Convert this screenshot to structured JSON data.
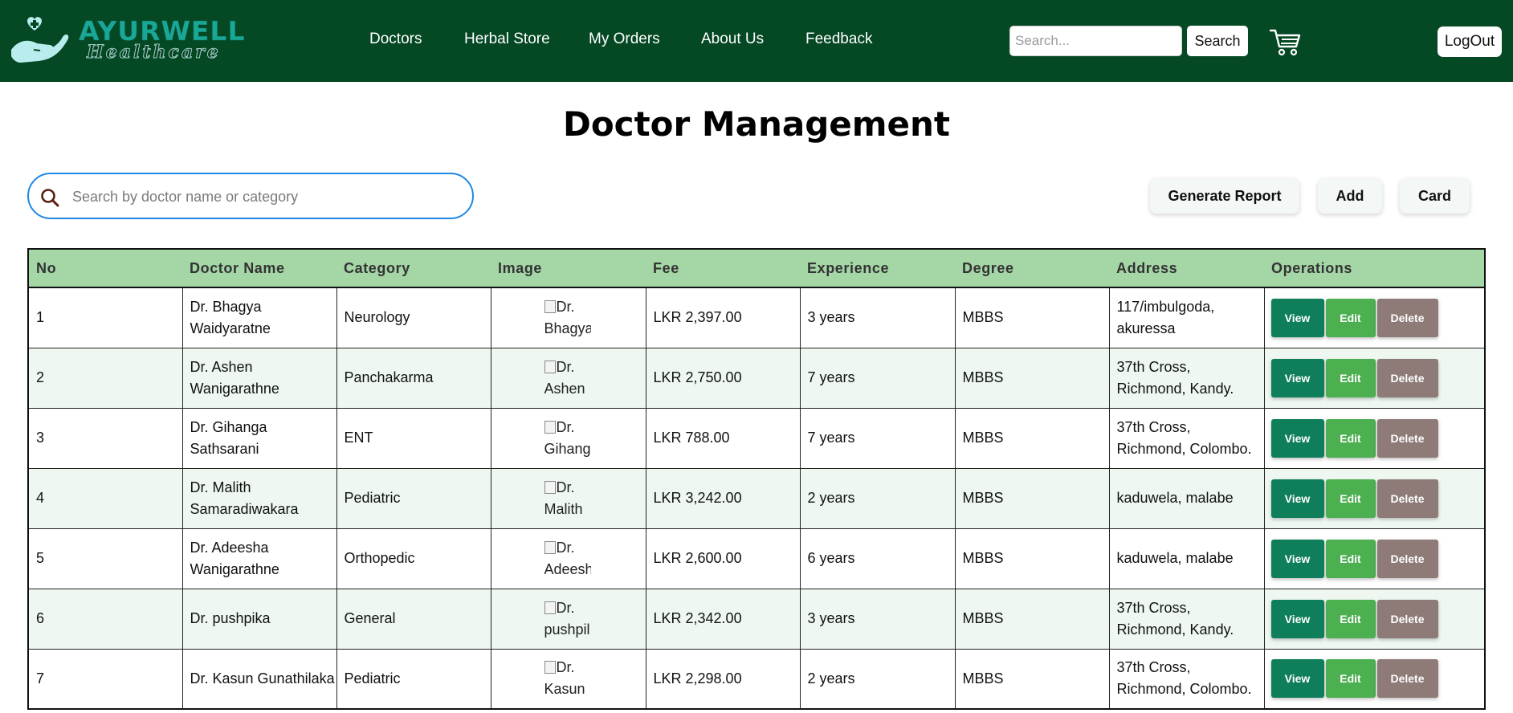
{
  "header": {
    "brand": "AYURWELL",
    "brand_sub": "Healthcare",
    "nav": [
      "Doctors",
      "Herbal Store",
      "My Orders",
      "About Us",
      "Feedback"
    ],
    "search_placeholder": "Search...",
    "search_label": "Search",
    "logout_label": "LogOut"
  },
  "page": {
    "title": "Doctor Management",
    "search_placeholder": "Search by doctor name or category",
    "actions": [
      "Generate Report",
      "Add",
      "Card"
    ]
  },
  "table": {
    "columns": [
      "No",
      "Doctor Name",
      "Category",
      "Image",
      "Fee",
      "Experience",
      "Degree",
      "Address",
      "Operations"
    ],
    "operations": [
      "View",
      "Edit",
      "Delete"
    ],
    "rows": [
      {
        "no": "1",
        "name": "Dr. Bhagya Waidyaratne",
        "category": "Neurology",
        "image_alt": "Dr. Bhagya",
        "fee": "LKR 2,397.00",
        "experience": "3 years",
        "degree": "MBBS",
        "address": "117/imbulgoda, akuressa"
      },
      {
        "no": "2",
        "name": "Dr. Ashen Wanigarathne",
        "category": "Panchakarma",
        "image_alt": "Dr. Ashen",
        "fee": "LKR 2,750.00",
        "experience": "7 years",
        "degree": "MBBS",
        "address": "37th Cross, Richmond, Kandy."
      },
      {
        "no": "3",
        "name": "Dr. Gihanga Sathsarani",
        "category": "ENT",
        "image_alt": "Dr. Gihang",
        "fee": "LKR 788.00",
        "experience": "7 years",
        "degree": "MBBS",
        "address": "37th Cross, Richmond, Colombo."
      },
      {
        "no": "4",
        "name": "Dr. Malith Samaradiwakara",
        "category": "Pediatric",
        "image_alt": "Dr. Malith",
        "fee": "LKR 3,242.00",
        "experience": "2 years",
        "degree": "MBBS",
        "address": "kaduwela, malabe"
      },
      {
        "no": "5",
        "name": "Dr. Adeesha Wanigarathne",
        "category": "Orthopedic",
        "image_alt": "Dr. Adeesh",
        "fee": "LKR 2,600.00",
        "experience": "6 years",
        "degree": "MBBS",
        "address": "kaduwela, malabe"
      },
      {
        "no": "6",
        "name": "Dr. pushpika",
        "category": "General",
        "image_alt": "Dr. pushpil",
        "fee": "LKR 2,342.00",
        "experience": "3 years",
        "degree": "MBBS",
        "address": "37th Cross, Richmond, Kandy."
      },
      {
        "no": "7",
        "name": "Dr. Kasun Gunathilaka",
        "category": "Pediatric",
        "image_alt": "Dr. Kasun",
        "fee": "LKR 2,298.00",
        "experience": "2 years",
        "degree": "MBBS",
        "address": "37th Cross, Richmond, Colombo."
      }
    ]
  },
  "icons": {
    "logo": "heart-hand-icon",
    "cart": "cart-icon",
    "search": "search-icon"
  },
  "colors": {
    "header_bg": "#044824",
    "table_header_bg": "#a4d6a6",
    "row_alt_bg": "#eef8f1",
    "view_btn": "#0f7f5b",
    "edit_btn": "#4caf50",
    "delete_btn": "#8e7b77",
    "search_border": "#1e88e5"
  }
}
